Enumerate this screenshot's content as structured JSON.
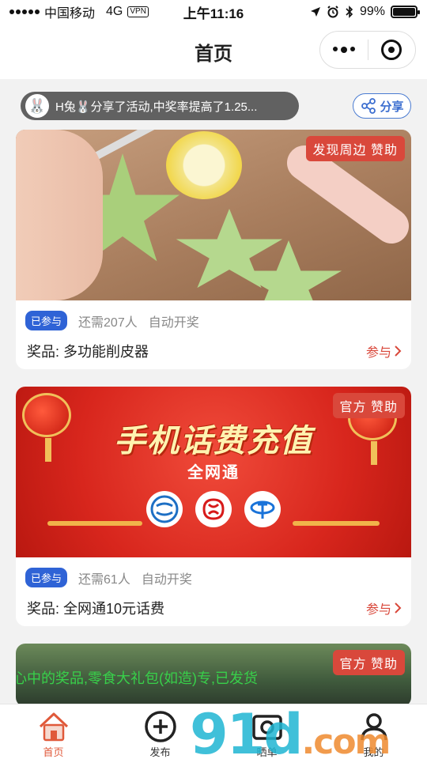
{
  "status_bar": {
    "carrier": "中国移动",
    "network": "4G",
    "vpn": "VPN",
    "time": "上午11:16",
    "battery": "99%",
    "battery_level": 0.99
  },
  "nav": {
    "title": "首页"
  },
  "notice": {
    "text": "H兔🐰分享了活动,中奖率提高了1.25...",
    "share_label": "分享"
  },
  "cards": [
    {
      "sponsor": "发现周边 赞助",
      "badge": "已参与",
      "remaining": "还需207人",
      "mode": "自动开奖",
      "prize": "奖品: 多功能削皮器",
      "action": "参与"
    },
    {
      "sponsor": "官方 赞助",
      "banner_title": "手机话费充值",
      "banner_sub": "全网通",
      "badge": "已参与",
      "remaining": "还需61人",
      "mode": "自动开奖",
      "prize": "奖品: 全网通10元话费",
      "action": "参与"
    },
    {
      "sponsor": "官方 赞助",
      "marquee": "心中的奖品,零食大礼包(如造)专,已发货"
    }
  ],
  "tabs": [
    {
      "label": "首页"
    },
    {
      "label": "发布"
    },
    {
      "label": "晒单"
    },
    {
      "label": "我的"
    }
  ],
  "watermark": {
    "main": "91d",
    "suffix": ".com"
  },
  "colors": {
    "accent_blue": "#2f63d6",
    "accent_red": "#d9483b",
    "tab_active": "#e0593a"
  },
  "icons": {
    "share": "share-icon",
    "chevron": "chevron-right-icon",
    "home": "home-icon",
    "publish": "plus-circle-icon",
    "showcase": "camera-icon",
    "profile": "user-icon"
  }
}
